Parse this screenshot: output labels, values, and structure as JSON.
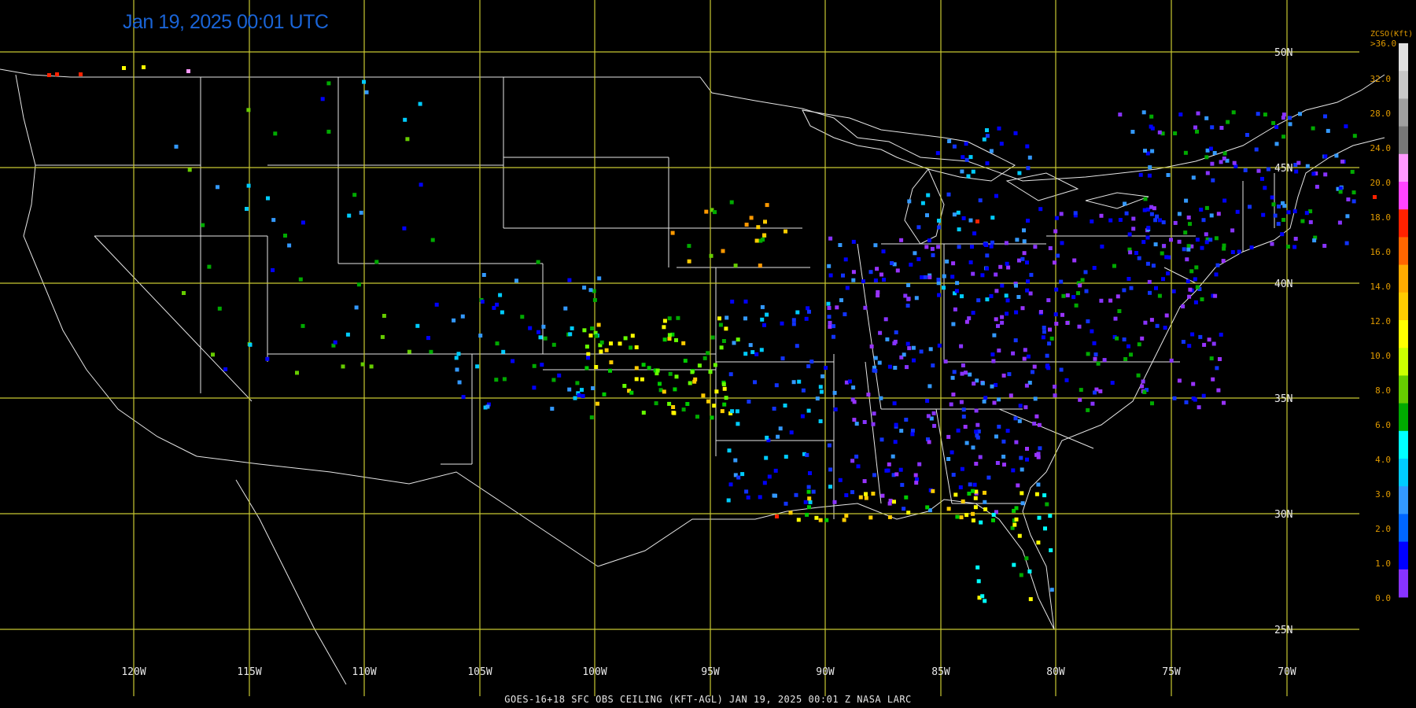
{
  "title": "Jan 19, 2025 00:01 UTC",
  "footer": "GOES-16+18  SFC OBS CEILING (KFT-AGL)   JAN 19, 2025 00:01 Z   NASA LARC",
  "colors": {
    "grid": "#c8c832",
    "boundary": "#e6e6e6",
    "title": "#1a64d6",
    "legend_text": "#e09a00"
  },
  "map": {
    "lon_labels": [
      "120W",
      "115W",
      "110W",
      "105W",
      "100W",
      "95W",
      "90W",
      "85W",
      "80W",
      "75W",
      "70W"
    ],
    "lat_labels": [
      "50N",
      "45N",
      "40N",
      "35N",
      "30N",
      "25N"
    ]
  },
  "legend": {
    "title": "ZCSO(Kft)",
    "top_label": ">36.0",
    "ticks": [
      "32.0",
      "28.0",
      "24.0",
      "20.0",
      "18.0",
      "16.0",
      "14.0",
      "12.0",
      "10.0",
      "8.0",
      "6.0",
      "4.0",
      "3.0",
      "2.0",
      "1.0",
      "0.0"
    ],
    "bands": [
      "#e0e0e0",
      "#c8c8c8",
      "#a0a0a0",
      "#787878",
      "#ff99ff",
      "#ff44ff",
      "#ff2200",
      "#ff6600",
      "#ffaa00",
      "#ffcc00",
      "#ffff00",
      "#ccff00",
      "#66cc00",
      "#00aa00",
      "#00ffff",
      "#00ccff",
      "#3399ff",
      "#0066ff",
      "#0000ff",
      "#8833ff"
    ]
  }
}
